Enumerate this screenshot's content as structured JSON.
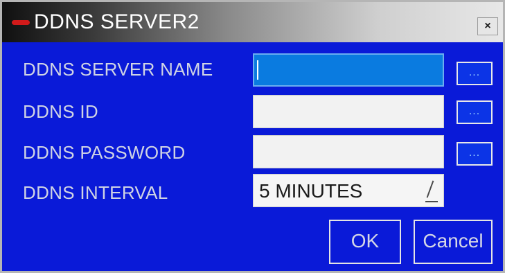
{
  "dialog": {
    "title": "DDNS SERVER2",
    "close_label": "×"
  },
  "form": {
    "server_name_label": "DDNS SERVER NAME",
    "server_name_value": "",
    "id_label": "DDNS ID",
    "id_value": "",
    "password_label": "DDNS PASSWORD",
    "password_value": "",
    "interval_label": "DDNS INTERVAL",
    "interval_value": "5 MINUTES",
    "browse_label": "..."
  },
  "buttons": {
    "ok_label": "OK",
    "cancel_label": "Cancel"
  },
  "colors": {
    "dialog_bg": "#0a1ad8",
    "active_field": "#0a7be0",
    "field_bg": "#f2f2f2",
    "title_mark": "#d21a1a"
  }
}
